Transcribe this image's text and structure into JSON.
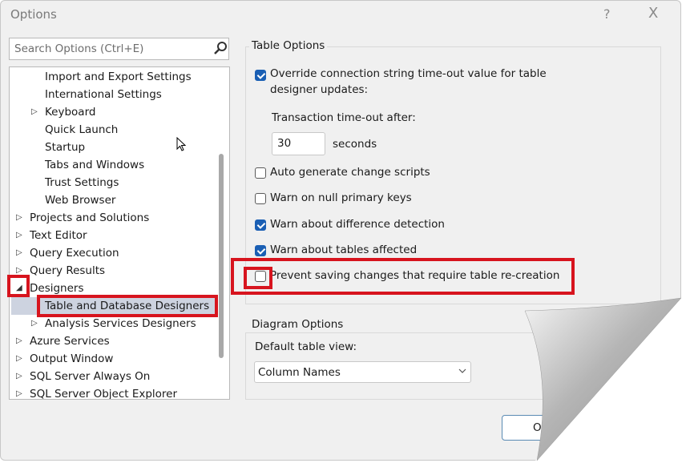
{
  "window": {
    "title": "Options",
    "help_label": "?",
    "close_label": "X"
  },
  "search": {
    "placeholder": "Search Options (Ctrl+E)",
    "icon": "search-icon"
  },
  "tree": {
    "items": [
      {
        "label": "Import and Export Settings",
        "level": 1,
        "expander": "none"
      },
      {
        "label": "International Settings",
        "level": 1,
        "expander": "none"
      },
      {
        "label": "Keyboard",
        "level": 1,
        "expander": "collapsed"
      },
      {
        "label": "Quick Launch",
        "level": 1,
        "expander": "none"
      },
      {
        "label": "Startup",
        "level": 1,
        "expander": "none"
      },
      {
        "label": "Tabs and Windows",
        "level": 1,
        "expander": "none"
      },
      {
        "label": "Trust Settings",
        "level": 1,
        "expander": "none"
      },
      {
        "label": "Web Browser",
        "level": 1,
        "expander": "none"
      },
      {
        "label": "Projects and Solutions",
        "level": 0,
        "expander": "collapsed"
      },
      {
        "label": "Text Editor",
        "level": 0,
        "expander": "collapsed"
      },
      {
        "label": "Query Execution",
        "level": 0,
        "expander": "collapsed"
      },
      {
        "label": "Query Results",
        "level": 0,
        "expander": "collapsed"
      },
      {
        "label": "Designers",
        "level": 0,
        "expander": "expanded"
      },
      {
        "label": "Table and Database Designers",
        "level": 1,
        "expander": "none",
        "selected": true
      },
      {
        "label": "Analysis Services Designers",
        "level": 1,
        "expander": "collapsed"
      },
      {
        "label": "Azure Services",
        "level": 0,
        "expander": "collapsed"
      },
      {
        "label": "Output Window",
        "level": 0,
        "expander": "collapsed"
      },
      {
        "label": "SQL Server Always On",
        "level": 0,
        "expander": "collapsed"
      },
      {
        "label": "SQL Server Object Explorer",
        "level": 0,
        "expander": "collapsed"
      }
    ]
  },
  "table_options": {
    "title": "Table Options",
    "override_line1": "Override connection string time-out value for table",
    "override_line2": "designer updates:",
    "override_checked": true,
    "timeout_label": "Transaction time-out after:",
    "timeout_value": "30",
    "timeout_unit": "seconds",
    "options": [
      {
        "label": "Auto generate change scripts",
        "checked": false
      },
      {
        "label": "Warn on null primary keys",
        "checked": false
      },
      {
        "label": "Warn about difference detection",
        "checked": true
      },
      {
        "label": "Warn about tables affected",
        "checked": true
      },
      {
        "label": "Prevent saving changes that require table re-creation",
        "checked": false
      }
    ]
  },
  "diagram_options": {
    "title": "Diagram Options",
    "default_view_label": "Default table view:",
    "default_view_value": "Column Names"
  },
  "footer": {
    "ok_label": "OK"
  },
  "colors": {
    "highlight": "#d7141e",
    "checkbox": "#1a5fb4",
    "selection": "#cdd3e0"
  }
}
